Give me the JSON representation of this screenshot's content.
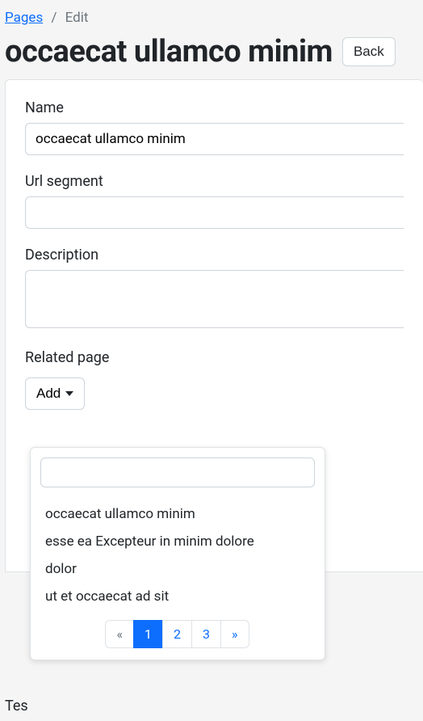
{
  "breadcrumb": {
    "parent": "Pages",
    "current": "Edit"
  },
  "title": "occaecat ullamco minim",
  "back_label": "Back",
  "fields": {
    "name_label": "Name",
    "name_value": "occaecat ullamco minim",
    "url_label": "Url segment",
    "url_value": "",
    "desc_label": "Description",
    "desc_value": "",
    "related_label": "Related page",
    "add_label": "Add"
  },
  "dropdown": {
    "search_value": "",
    "items": [
      "occaecat ullamco minim",
      "esse ea Excepteur in minim dolore",
      "dolor",
      "ut et occaecat ad sit"
    ],
    "prev": "«",
    "p1": "1",
    "p2": "2",
    "p3": "3",
    "next": "»"
  },
  "bottom_stub": "Tes"
}
